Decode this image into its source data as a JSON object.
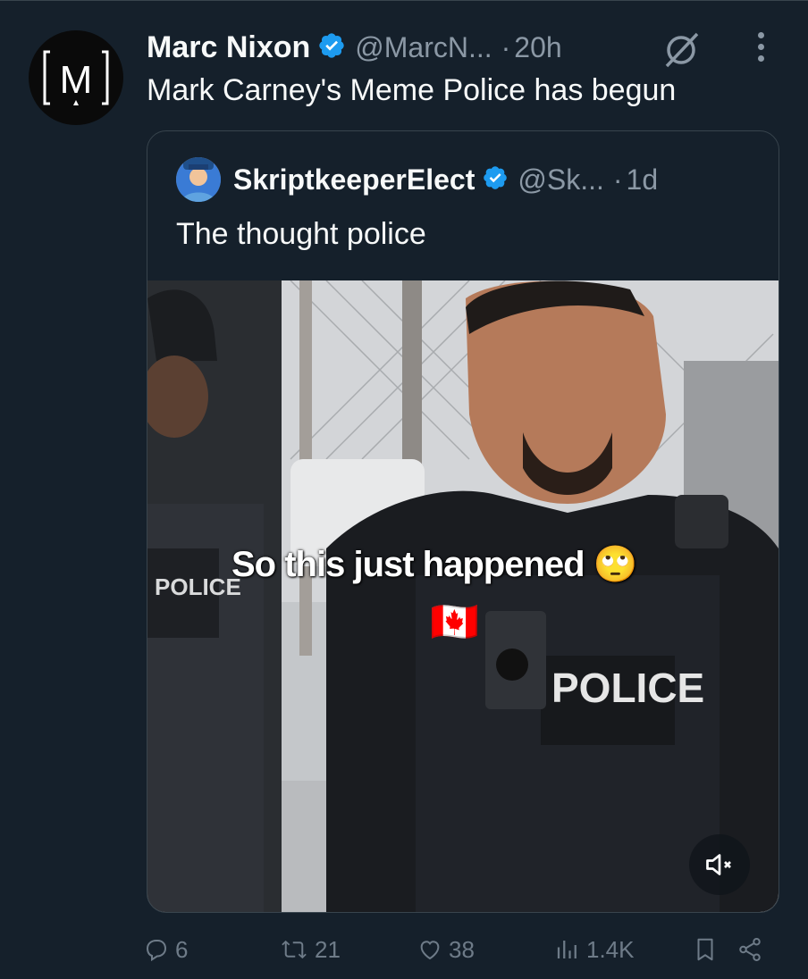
{
  "tweet": {
    "author_name": "Marc Nixon",
    "author_handle": "@MarcN...",
    "separator": "·",
    "time": "20h",
    "avatar_letter": "M",
    "text": "Mark Carney's Meme Police has begun"
  },
  "quoted": {
    "author_name": "SkriptkeeperElect",
    "author_handle": "@Sk...",
    "separator": "·",
    "time": "1d",
    "text": "The thought police",
    "media": {
      "overlay_caption": "So this just happened",
      "overlay_emoji": "🙄",
      "overlay_flag": "🇨🇦",
      "vest_label": "POLICE",
      "side_vest_label": "POLICE"
    }
  },
  "actions": {
    "replies": "6",
    "reposts": "21",
    "likes": "38",
    "views": "1.4K"
  },
  "colors": {
    "background": "#15202b",
    "verified": "#1d9bf0",
    "muted_text": "#8b98a5",
    "action_icon": "#6e7b88"
  }
}
